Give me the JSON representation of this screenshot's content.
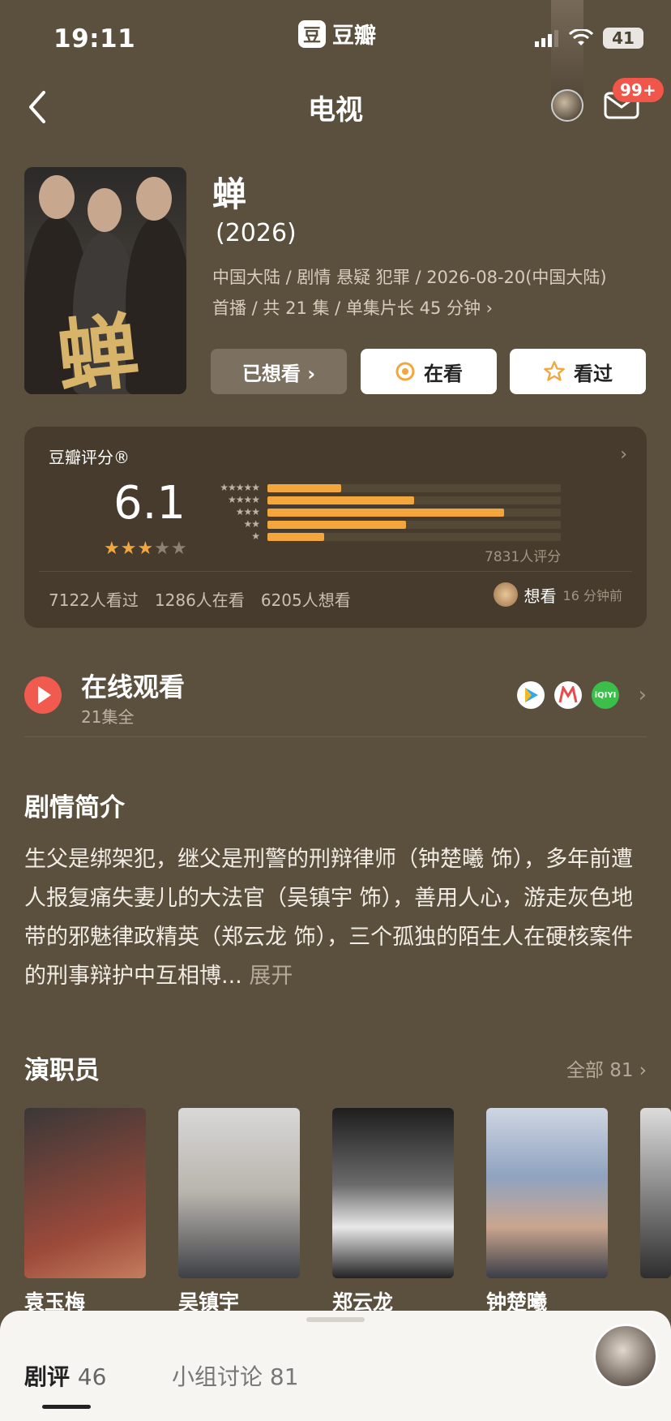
{
  "status_bar": {
    "time": "19:11",
    "app_logo": "豆",
    "app_name": "豆瓣",
    "battery": "41"
  },
  "header": {
    "title": "电视",
    "badge": "99+"
  },
  "movie": {
    "title": "蝉",
    "year": "(2026)",
    "meta_line1": "中国大陆 / 剧情 悬疑 犯罪 / 2026-08-20(中国大陆)",
    "meta_line2": "首播 / 共 21 集 / 单集片长 45 分钟 ›",
    "poster_glyph": "蝉"
  },
  "actions": {
    "wish": "已想看 ›",
    "watching": "在看",
    "watched": "看过"
  },
  "rating": {
    "label": "豆瓣评分®",
    "score": "6.1",
    "stars_filled": 3,
    "stars_total": 5,
    "distribution_percent": [
      9,
      18,
      29,
      17,
      7
    ],
    "rating_count": "7831人评分",
    "stats": {
      "watched": "7122人看过",
      "watching": "1286人在看",
      "wish": "6205人想看"
    },
    "recent": {
      "action": "想看",
      "time": "16 分钟前"
    }
  },
  "online": {
    "title": "在线观看",
    "subtitle": "21集全",
    "platforms": [
      "tencent-video-icon",
      "mgtv-icon",
      "iqiyi-icon"
    ],
    "iqiyi_text": "iQIYI"
  },
  "synopsis": {
    "title": "剧情简介",
    "text": "生父是绑架犯，继父是刑警的刑辩律师（钟楚曦 饰），多年前遭人报复痛失妻儿的大法官（吴镇宇 饰），善用人心，游走灰色地带的邪魅律政精英（郑云龙 饰），三个孤独的陌生人在硬核案件的刑事辩护中互相博...",
    "more": "展开"
  },
  "cast": {
    "title": "演职员",
    "all_label": "全部 81 ›",
    "members": [
      {
        "name": "袁玉梅"
      },
      {
        "name": "吴镇宇"
      },
      {
        "name": "郑云龙"
      },
      {
        "name": "钟楚曦"
      }
    ]
  },
  "bottom_sheet": {
    "tab1_label": "剧评",
    "tab1_count": "46",
    "tab2_label": "小组讨论",
    "tab2_count": "81"
  }
}
